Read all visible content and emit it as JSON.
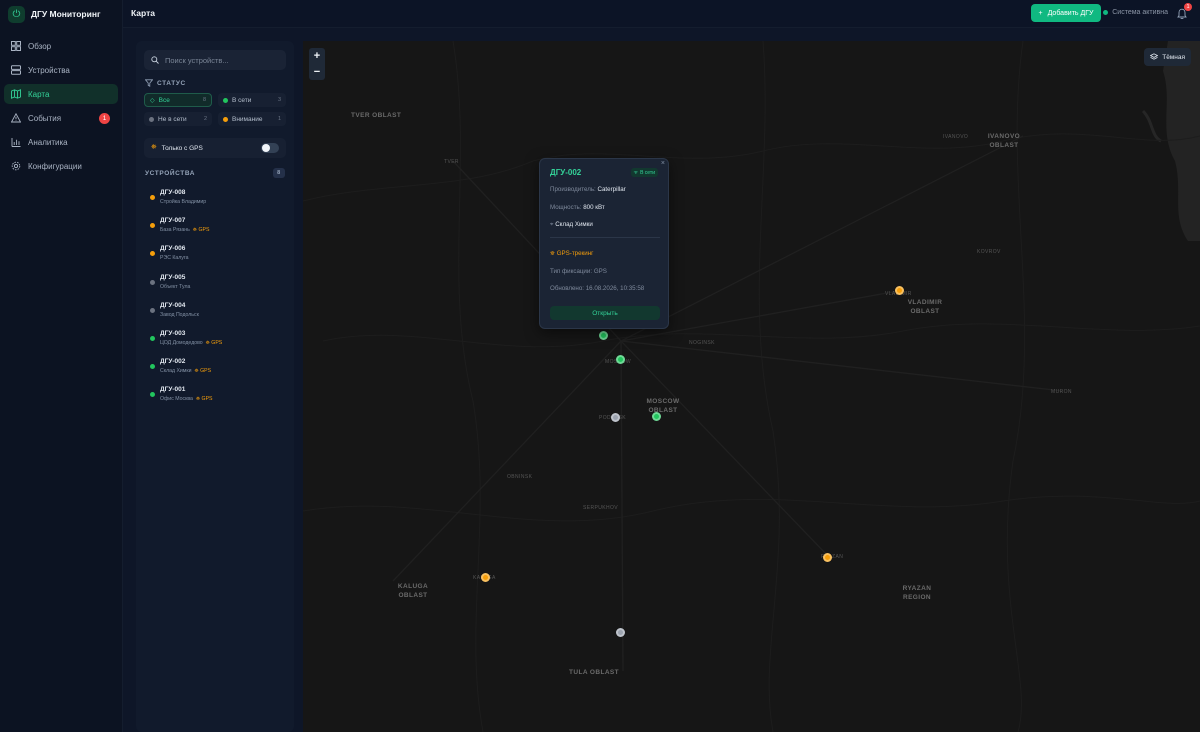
{
  "app": {
    "name": "ДГУ Мониторинг"
  },
  "colors": {
    "accent": "#10b981",
    "online": "#22c55e",
    "warning": "#f59e0b",
    "offline": "#6b7280",
    "danger": "#ef4444"
  },
  "sidebar": {
    "items": [
      {
        "label": "Обзор",
        "icon": "grid-icon"
      },
      {
        "label": "Устройства",
        "icon": "server-icon"
      },
      {
        "label": "Карта",
        "icon": "map-icon",
        "active": true
      },
      {
        "label": "События",
        "icon": "alert-triangle-icon",
        "badge": "1"
      },
      {
        "label": "Аналитика",
        "icon": "bar-chart-icon"
      },
      {
        "label": "Конфигурации",
        "icon": "gear-icon"
      }
    ]
  },
  "header": {
    "title": "Карта",
    "add_button": "Добавить ДГУ",
    "system_status": "Система активна",
    "notifications_count": "1"
  },
  "panel": {
    "search_placeholder": "Поиск устройств...",
    "status_label": "СТАТУС",
    "filters": [
      {
        "label": "Все",
        "count": "8"
      },
      {
        "label": "В сети",
        "count": "3"
      },
      {
        "label": "Не в сети",
        "count": "2"
      },
      {
        "label": "Внимание",
        "count": "1"
      }
    ],
    "gps_only_label": "Только с GPS",
    "gps_only_enabled": false,
    "devices_label": "УСТРОЙСТВА",
    "devices_count": "8",
    "gps_tag": "GPS",
    "devices": [
      {
        "name": "ДГУ-008",
        "location": "Стройка Владимир",
        "status": "warning",
        "gps": false
      },
      {
        "name": "ДГУ-007",
        "location": "База Рязань",
        "status": "warning",
        "gps": true
      },
      {
        "name": "ДГУ-006",
        "location": "РЭС Калуга",
        "status": "warning",
        "gps": false
      },
      {
        "name": "ДГУ-005",
        "location": "Объект Тула",
        "status": "offline",
        "gps": false
      },
      {
        "name": "ДГУ-004",
        "location": "Завод Подольск",
        "status": "offline",
        "gps": false
      },
      {
        "name": "ДГУ-003",
        "location": "ЦОД Домодедово",
        "status": "online",
        "gps": true
      },
      {
        "name": "ДГУ-002",
        "location": "Склад Химки",
        "status": "online",
        "gps": true
      },
      {
        "name": "ДГУ-001",
        "location": "Офис Москва",
        "status": "online",
        "gps": true
      }
    ]
  },
  "map": {
    "zoom_in": "+",
    "zoom_out": "−",
    "theme_button": "Тёмная",
    "labels": [
      {
        "text": "TVER OBLAST",
        "kind": "region"
      },
      {
        "text": "IVANOVO OBLAST",
        "kind": "region"
      },
      {
        "text": "VLADIMIR OBLAST",
        "kind": "region"
      },
      {
        "text": "MOSCOW OBLAST",
        "kind": "region"
      },
      {
        "text": "KALUGA OBLAST",
        "kind": "region"
      },
      {
        "text": "RYAZAN REGION",
        "kind": "region"
      },
      {
        "text": "TULA OBLAST",
        "kind": "region"
      },
      {
        "text": "IVANOVO",
        "kind": "city"
      },
      {
        "text": "TVER",
        "kind": "city"
      },
      {
        "text": "KOVROV",
        "kind": "city"
      },
      {
        "text": "VLADIMIR",
        "kind": "city"
      },
      {
        "text": "NOGINSK",
        "kind": "city"
      },
      {
        "text": "MOSCOW",
        "kind": "city"
      },
      {
        "text": "MURON",
        "kind": "city"
      },
      {
        "text": "PODOLSK",
        "kind": "city"
      },
      {
        "text": "OBNINSK",
        "kind": "city"
      },
      {
        "text": "SERPUKHOV",
        "kind": "city"
      },
      {
        "text": "KALUGA",
        "kind": "city"
      },
      {
        "text": "RYAZAN",
        "kind": "city"
      }
    ],
    "popup": {
      "title": "ДГУ-002",
      "badge": "В сети",
      "close": "×",
      "manufacturer_label": "Производитель:",
      "manufacturer": "Caterpillar",
      "power_label": "Мощность:",
      "power": "800 кВт",
      "location": "Склад Химки",
      "gps_label": "GPS-трекинг",
      "fix_label": "Тип фиксации:",
      "fix_type": "GPS",
      "updated_label": "Обновлено:",
      "updated": "16.08.2026, 10:35:58",
      "open_button": "Открыть"
    }
  }
}
